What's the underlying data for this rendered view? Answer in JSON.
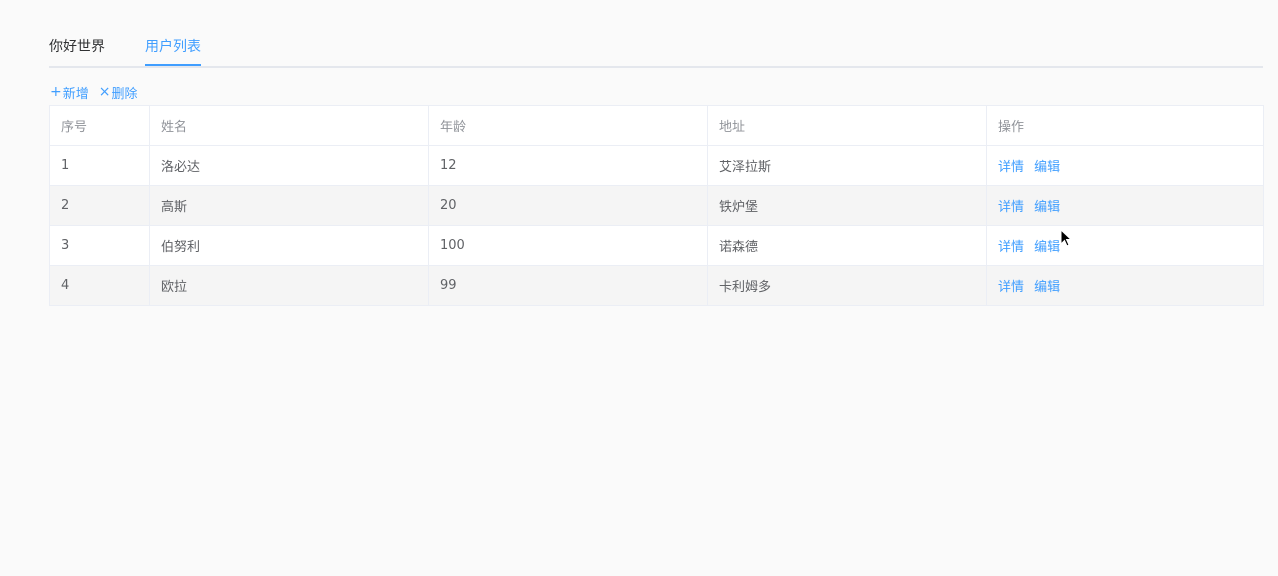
{
  "tabs": [
    {
      "label": "你好世界",
      "active": false
    },
    {
      "label": "用户列表",
      "active": true
    }
  ],
  "toolbar": {
    "add_label": "新增",
    "delete_label": "删除"
  },
  "table": {
    "headers": [
      "序号",
      "姓名",
      "年龄",
      "地址",
      "操作"
    ],
    "rows": [
      {
        "index": "1",
        "name": "洛必达",
        "age": "12",
        "address": "艾泽拉斯"
      },
      {
        "index": "2",
        "name": "高斯",
        "age": "20",
        "address": "铁炉堡"
      },
      {
        "index": "3",
        "name": "伯努利",
        "age": "100",
        "address": "诺森德"
      },
      {
        "index": "4",
        "name": "欧拉",
        "age": "99",
        "address": "卡利姆多"
      }
    ],
    "actions": {
      "detail": "详情",
      "edit": "编辑"
    }
  },
  "colors": {
    "accent": "#409eff",
    "text": "#606266",
    "header_text": "#909399",
    "border": "#ebeef5"
  }
}
